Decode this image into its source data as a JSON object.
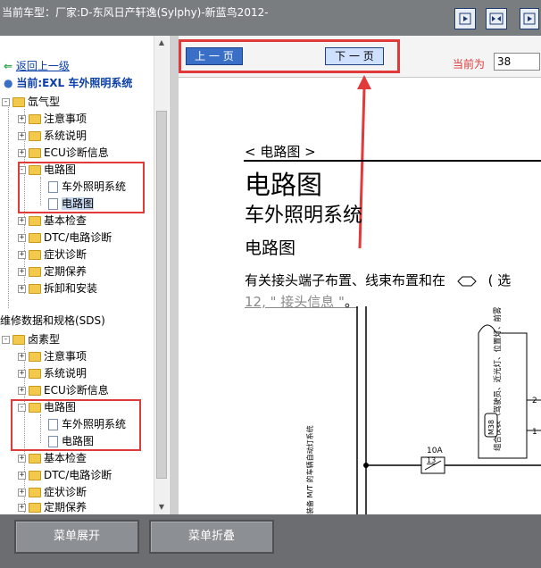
{
  "titlebar": {
    "title": "当前车型：厂家:D-东风日产轩逸(Sylphy)-新蓝鸟2012-"
  },
  "toolbar": {
    "buttons": [
      "right-arrow-icon",
      "expand-arrows-icon",
      "right-arrow-icon"
    ]
  },
  "sidebar": {
    "back": "返回上一级",
    "current": "当前:EXL 车外照明系统",
    "items": [
      {
        "label": "氙气型"
      },
      {
        "label": "注意事项"
      },
      {
        "label": "系统说明"
      },
      {
        "label": "ECU诊断信息"
      },
      {
        "label": "电路图"
      },
      {
        "label": "车外照明系统"
      },
      {
        "label": "电路图"
      },
      {
        "label": "基本检查"
      },
      {
        "label": "DTC/电路诊断"
      },
      {
        "label": "症状诊断"
      },
      {
        "label": "定期保养"
      },
      {
        "label": "拆卸和安装"
      },
      {
        "label": "维修数据和规格(SDS)"
      },
      {
        "label": "卤素型"
      },
      {
        "label": "注意事项"
      },
      {
        "label": "系统说明"
      },
      {
        "label": "ECU诊断信息"
      },
      {
        "label": "电路图"
      },
      {
        "label": "车外照明系统"
      },
      {
        "label": "电路图"
      },
      {
        "label": "基本检查"
      },
      {
        "label": "DTC/电路诊断"
      },
      {
        "label": "症状诊断"
      },
      {
        "label": "定期保养"
      }
    ]
  },
  "nav": {
    "prev": "上 一 页",
    "next": "下 一 页",
    "page_label": "当前为",
    "page_value": "38"
  },
  "document": {
    "crumb": "< 电路图 >",
    "h1": "电路图",
    "h2": "车外照明系统",
    "h3": "电路图",
    "para": "有关接头端子布置、线束布置和在",
    "para_tail": "( 选",
    "link": "12, \" 接头信息 \"",
    "link_end": "。",
    "diagram": {
      "fuse": "10A",
      "fuse_num": "13",
      "pin_2": "2",
      "pin_1": "1",
      "component_label": "组合仪表（驾驶员、近光灯、位置灯、前雾灯、后雾灯、转向信号灯）",
      "connector": "M38",
      "vertical_text": "装备 M/T 的车辆自动灯系统"
    },
    "note_icon": "connector-oval-icon"
  },
  "bottom": {
    "expand": "菜单展开",
    "collapse": "菜单折叠"
  }
}
